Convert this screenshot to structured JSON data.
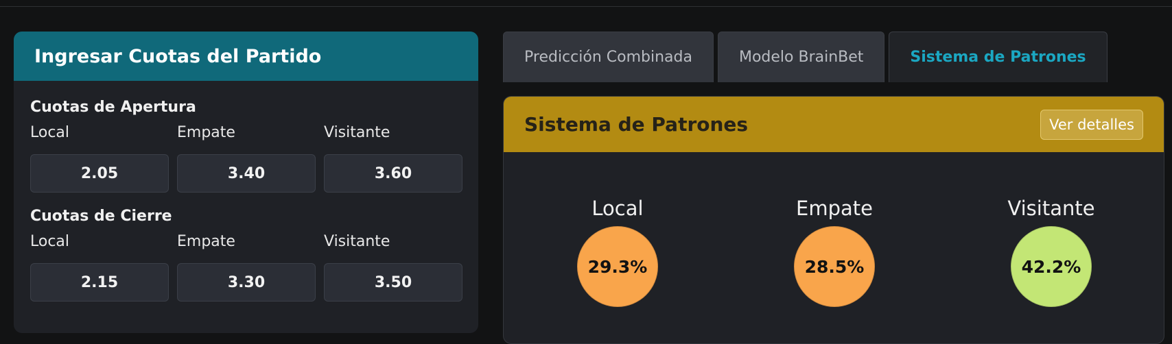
{
  "odds_panel": {
    "title": "Ingresar Cuotas del Partido",
    "opening": {
      "title": "Cuotas de Apertura",
      "fields": [
        {
          "label": "Local",
          "value": "2.05"
        },
        {
          "label": "Empate",
          "value": "3.40"
        },
        {
          "label": "Visitante",
          "value": "3.60"
        }
      ]
    },
    "closing": {
      "title": "Cuotas de Cierre",
      "fields": [
        {
          "label": "Local",
          "value": "2.15"
        },
        {
          "label": "Empate",
          "value": "3.30"
        },
        {
          "label": "Visitante",
          "value": "3.50"
        }
      ]
    }
  },
  "tabs": [
    {
      "label": "Predicción Combinada",
      "active": false
    },
    {
      "label": "Modelo BrainBet",
      "active": false
    },
    {
      "label": "Sistema de Patrones",
      "active": true
    }
  ],
  "pattern_panel": {
    "title": "Sistema de Patrones",
    "details_label": "Ver detalles",
    "results": [
      {
        "label": "Local",
        "value": "29.3%",
        "color": "#f9a54b"
      },
      {
        "label": "Empate",
        "value": "28.5%",
        "color": "#f9a54b"
      },
      {
        "label": "Visitante",
        "value": "42.2%",
        "color": "#c3e675"
      }
    ]
  },
  "colors": {
    "odds_header": "#10697a",
    "pattern_header": "#b38b12",
    "active_tab_text": "#1ba7c2"
  }
}
